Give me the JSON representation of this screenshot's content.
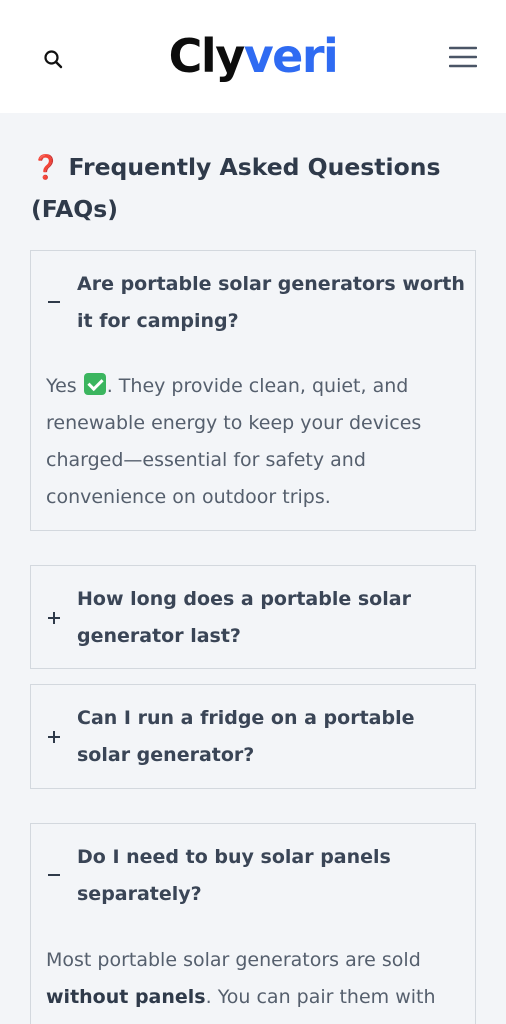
{
  "header": {
    "logo_part1": "Cly",
    "logo_part2": "veri",
    "search_icon": "search-icon",
    "menu_icon": "hamburger-menu-icon"
  },
  "faq": {
    "title_emoji": "❓",
    "title": "Frequently Asked Questions (FAQs)",
    "items": [
      {
        "question": "Are portable solar generators worth it for camping?",
        "state": "expanded",
        "toggle": "−",
        "answer_start": "Yes",
        "answer_emoji": "check-mark-emoji",
        "answer_rest": ". They provide clean, quiet, and renewable energy to keep your devices charged—essential for safety and convenience on outdoor trips."
      },
      {
        "question": "How long does a portable solar generator last?",
        "state": "collapsed",
        "toggle": "+"
      },
      {
        "question": "Can I run a fridge on a portable solar generator?",
        "state": "collapsed",
        "toggle": "+"
      },
      {
        "question": "Do I need to buy solar panels separately?",
        "state": "expanded",
        "toggle": "−",
        "answer_start": "Most portable solar generators are sold ",
        "answer_bold": "without panels",
        "answer_rest": ". You can pair them with"
      }
    ]
  },
  "colors": {
    "brand_dark": "#0d0d0d",
    "brand_blue": "#2f6bf2",
    "page_bg": "#f3f5f8",
    "card_border": "#d3d8de",
    "title_emoji": "#e0322f",
    "check_emoji": "#3bb55f"
  }
}
